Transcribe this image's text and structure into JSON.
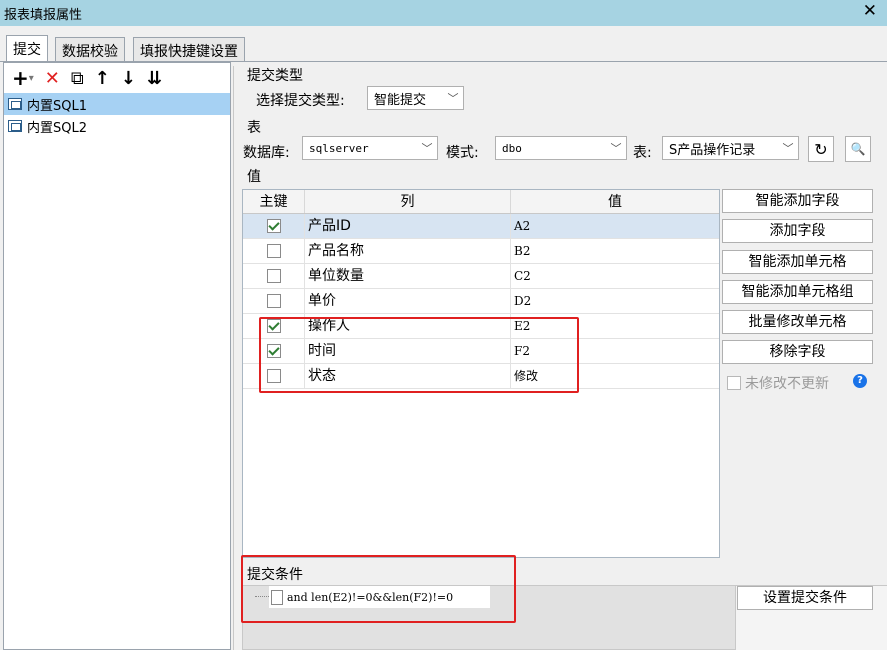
{
  "window": {
    "title": "报表填报属性",
    "close_glyph": "✕"
  },
  "tabs": [
    {
      "label": "提交",
      "active": true
    },
    {
      "label": "数据校验",
      "active": false
    },
    {
      "label": "填报快捷键设置",
      "active": false
    }
  ],
  "left_toolbar": {
    "add_glyph": "+",
    "add_dropdown_glyph": "▾",
    "delete_glyph": "✕",
    "copy_glyph": "⧉",
    "up_glyph": "↑",
    "down_glyph": "↓",
    "sort_glyph": "⇊"
  },
  "tree_items": [
    {
      "label": "内置SQL1",
      "selected": true
    },
    {
      "label": "内置SQL2",
      "selected": false
    }
  ],
  "submit_type": {
    "section": "提交类型",
    "label": "选择提交类型:",
    "value": "智能提交"
  },
  "table_section": {
    "section": "表",
    "db_label": "数据库:",
    "db_value": "sqlserver",
    "schema_label": "模式:",
    "schema_value": "dbo",
    "table_label": "表:",
    "table_value": "S产品操作记录",
    "refresh_glyph": "↻",
    "preview_glyph": "🔍"
  },
  "values_section": {
    "section": "值",
    "headers": {
      "key": "主键",
      "column": "列",
      "value": "值"
    },
    "rows": [
      {
        "key": true,
        "column": "产品ID",
        "value": "A2",
        "selected": true
      },
      {
        "key": false,
        "column": "产品名称",
        "value": "B2",
        "selected": false
      },
      {
        "key": false,
        "column": "单位数量",
        "value": "C2",
        "selected": false
      },
      {
        "key": false,
        "column": "单价",
        "value": "D2",
        "selected": false
      },
      {
        "key": true,
        "column": "操作人",
        "value": "E2",
        "selected": false
      },
      {
        "key": true,
        "column": "时间",
        "value": "F2",
        "selected": false
      },
      {
        "key": false,
        "column": "状态",
        "value": "修改",
        "selected": false
      }
    ]
  },
  "buttons": {
    "smart_add_field": "智能添加字段",
    "add_field": "添加字段",
    "smart_add_cell": "智能添加单元格",
    "smart_add_cell_group": "智能添加单元格组",
    "batch_modify_cell": "批量修改单元格",
    "remove_field": "移除字段",
    "no_update_unchanged": "未修改不更新",
    "help_glyph": "?"
  },
  "submit_condition": {
    "section": "提交条件",
    "expression": "and len(E2)!=0&&len(F2)!=0",
    "set_button": "设置提交条件"
  },
  "colors": {
    "titlebar": "#a6d3e2",
    "selection": "#a6d1f3",
    "highlight": "#e02020"
  }
}
